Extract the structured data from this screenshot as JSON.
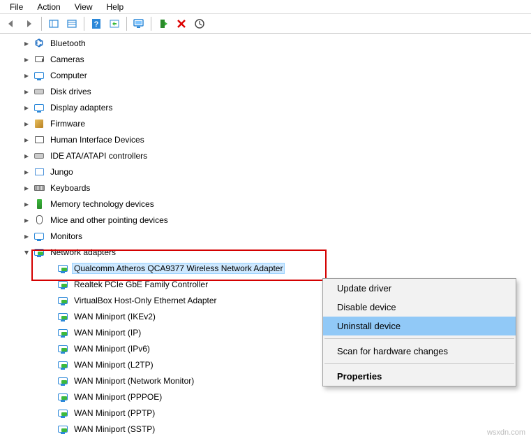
{
  "menubar": {
    "items": [
      "File",
      "Action",
      "View",
      "Help"
    ]
  },
  "toolbar_icons": [
    "back",
    "forward",
    "show-hide",
    "properties-pane",
    "help",
    "refresh",
    "monitor",
    "install",
    "delete",
    "scan"
  ],
  "tree": {
    "nodes": [
      {
        "key": "bt",
        "label": "Bluetooth",
        "icon": "bluetooth-icon"
      },
      {
        "key": "cam",
        "label": "Cameras",
        "icon": "camera-icon"
      },
      {
        "key": "comp",
        "label": "Computer",
        "icon": "monitor-icon"
      },
      {
        "key": "disk",
        "label": "Disk drives",
        "icon": "disk-icon"
      },
      {
        "key": "disp",
        "label": "Display adapters",
        "icon": "monitor-icon"
      },
      {
        "key": "firm",
        "label": "Firmware",
        "icon": "firmware-icon"
      },
      {
        "key": "hid",
        "label": "Human Interface Devices",
        "icon": "hid-icon"
      },
      {
        "key": "ide",
        "label": "IDE ATA/ATAPI controllers",
        "icon": "ide-icon"
      },
      {
        "key": "jungo",
        "label": "Jungo",
        "icon": "jungo-icon"
      },
      {
        "key": "kbd",
        "label": "Keyboards",
        "icon": "keyboard-icon"
      },
      {
        "key": "mem",
        "label": "Memory technology devices",
        "icon": "memory-icon"
      },
      {
        "key": "mouse",
        "label": "Mice and other pointing devices",
        "icon": "mouse-icon"
      },
      {
        "key": "mon",
        "label": "Monitors",
        "icon": "monitor-icon"
      }
    ],
    "network": {
      "label": "Network adapters",
      "icon": "netadapter-icon",
      "children": [
        {
          "key": "na0",
          "label": "Qualcomm Atheros QCA9377 Wireless Network Adapter",
          "selected": true
        },
        {
          "key": "na1",
          "label": "Realtek PCIe GbE Family Controller"
        },
        {
          "key": "na2",
          "label": "VirtualBox Host-Only Ethernet Adapter"
        },
        {
          "key": "na3",
          "label": "WAN Miniport (IKEv2)"
        },
        {
          "key": "na4",
          "label": "WAN Miniport (IP)"
        },
        {
          "key": "na5",
          "label": "WAN Miniport (IPv6)"
        },
        {
          "key": "na6",
          "label": "WAN Miniport (L2TP)"
        },
        {
          "key": "na7",
          "label": "WAN Miniport (Network Monitor)"
        },
        {
          "key": "na8",
          "label": "WAN Miniport (PPPOE)"
        },
        {
          "key": "na9",
          "label": "WAN Miniport (PPTP)"
        },
        {
          "key": "na10",
          "label": "WAN Miniport (SSTP)"
        }
      ]
    }
  },
  "context_menu": {
    "items": [
      {
        "key": "update",
        "label": "Update driver"
      },
      {
        "key": "disable",
        "label": "Disable device"
      },
      {
        "key": "uninstall",
        "label": "Uninstall device",
        "highlighted": true
      },
      {
        "key": "sep",
        "separator": true
      },
      {
        "key": "scan",
        "label": "Scan for hardware changes"
      },
      {
        "key": "sep2",
        "separator": true
      },
      {
        "key": "props",
        "label": "Properties",
        "bold": true
      }
    ]
  },
  "watermark": "wsxdn.com"
}
